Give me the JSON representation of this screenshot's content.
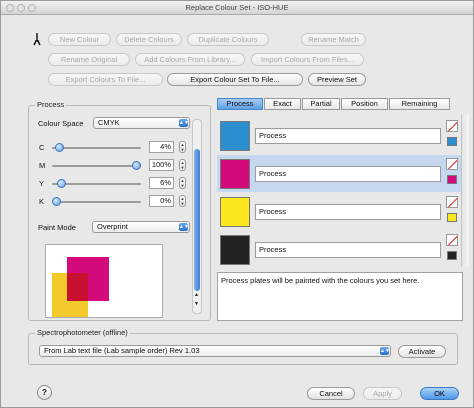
{
  "window": {
    "title": "Replace Colour Set - ISO-HUE"
  },
  "toolbar": {
    "row1": [
      "New Colour",
      "Delete Colours",
      "Duplicate Colours",
      "Rename Match"
    ],
    "row2": [
      "Rename Original",
      "Add Colours From Library...",
      "Import Colours From Files..."
    ],
    "row3": [
      "Export Colours To File...",
      "Export Colour Set To File...",
      "Preview Set"
    ]
  },
  "process_panel": {
    "group_label": "Process",
    "colour_space_label": "Colour Space",
    "colour_space_value": "CMYK",
    "channels": [
      {
        "label": "C",
        "value": "4%",
        "level": 0.04
      },
      {
        "label": "M",
        "value": "100%",
        "level": 1.0
      },
      {
        "label": "Y",
        "value": "6%",
        "level": 0.06
      },
      {
        "label": "K",
        "value": "0%",
        "level": 0.0
      }
    ],
    "paint_mode_label": "Paint Mode",
    "paint_mode_value": "Overprint"
  },
  "tabs": [
    "Process",
    "Exact",
    "Partial",
    "Position",
    "Remaining"
  ],
  "active_tab": "Process",
  "colour_rows": [
    {
      "name": "Process",
      "color": "#2b8ed1",
      "selected": false
    },
    {
      "name": "Process",
      "color": "#d4097b",
      "selected": true
    },
    {
      "name": "Process",
      "color": "#fae71c",
      "selected": false
    },
    {
      "name": "Process",
      "color": "#222222",
      "selected": false
    }
  ],
  "description": "Process plates will be painted with the colours you set here.",
  "spectro": {
    "group_label": "Spectrophotometer (offline)",
    "source_value": "From Lab text file (Lab sample order) Rev 1.03",
    "activate_label": "Activate"
  },
  "footer": {
    "cancel_label": "Cancel",
    "apply_label": "Apply",
    "ok_label": "OK"
  },
  "colors": {
    "accent": "#4f98e6",
    "cyan": "#2b8ed1",
    "magenta": "#d4097b",
    "yellow": "#fae71c",
    "black": "#222222"
  }
}
